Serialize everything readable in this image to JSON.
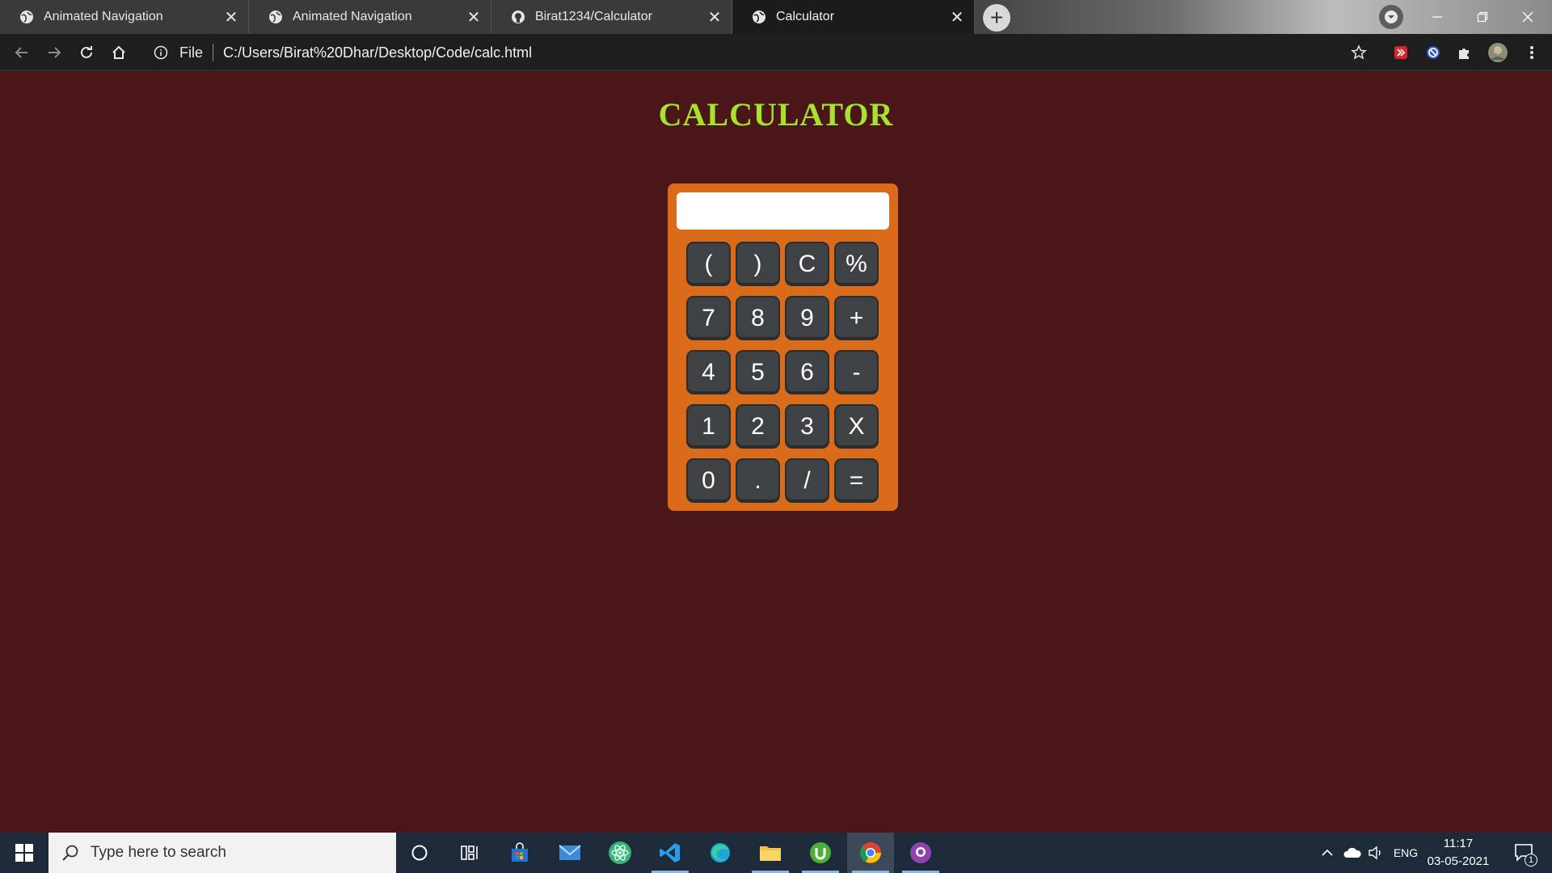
{
  "browser": {
    "tabs": [
      {
        "title": "Animated Navigation",
        "favicon": "globe-icon",
        "active": false
      },
      {
        "title": "Animated Navigation",
        "favicon": "globe-icon",
        "active": false
      },
      {
        "title": "Birat1234/Calculator",
        "favicon": "github-icon",
        "active": false
      },
      {
        "title": "Calculator",
        "favicon": "globe-icon",
        "active": true
      }
    ],
    "close_glyph": "✕",
    "new_tab_glyph": "+",
    "omnibox": {
      "scheme_label": "File",
      "url": "C:/Users/Birat%20Dhar/Desktop/Code/calc.html"
    }
  },
  "page": {
    "title": "CALCULATOR",
    "title_color": "#a6e22e",
    "background": "#4a1618",
    "calculator": {
      "body_color": "#d96b1a",
      "key_color": "#3f4244",
      "display_value": "",
      "keys": [
        "(",
        ")",
        "C",
        "%",
        "7",
        "8",
        "9",
        "+",
        "4",
        "5",
        "6",
        "-",
        "1",
        "2",
        "3",
        "X",
        "0",
        ".",
        "/",
        "="
      ]
    }
  },
  "taskbar": {
    "search_placeholder": "Type here to search",
    "apps": [
      "cortana-icon",
      "task-view-icon",
      "store-icon",
      "mail-icon",
      "atom-icon",
      "vscode-icon",
      "edge-icon",
      "file-explorer-icon",
      "utorrent-icon",
      "chrome-icon",
      "github-desktop-icon"
    ],
    "tray": {
      "language": "ENG",
      "time": "11:17",
      "date": "03-05-2021",
      "notification_count": "1"
    }
  }
}
